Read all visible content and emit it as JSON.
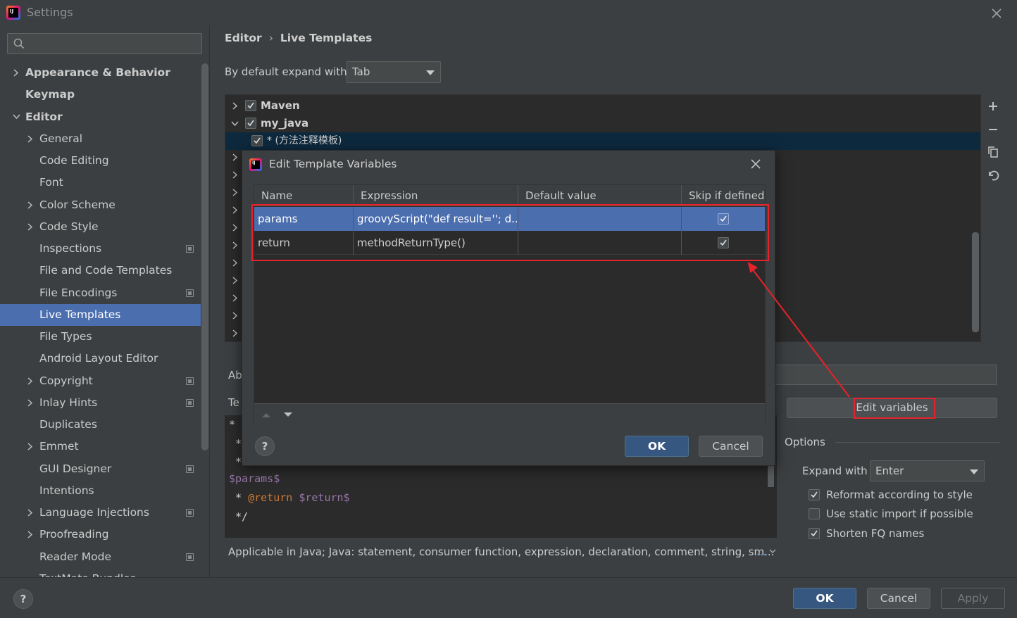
{
  "window": {
    "title": "Settings"
  },
  "sidebar": {
    "search_placeholder": "",
    "items": [
      {
        "label": "Appearance & Behavior",
        "level": 0,
        "expandable": true,
        "expanded": false,
        "bold": true
      },
      {
        "label": "Keymap",
        "level": 0,
        "expandable": false,
        "bold": true
      },
      {
        "label": "Editor",
        "level": 0,
        "expandable": true,
        "expanded": true,
        "bold": true
      },
      {
        "label": "General",
        "level": 1,
        "expandable": true
      },
      {
        "label": "Code Editing",
        "level": 1
      },
      {
        "label": "Font",
        "level": 1
      },
      {
        "label": "Color Scheme",
        "level": 1,
        "expandable": true
      },
      {
        "label": "Code Style",
        "level": 1,
        "expandable": true
      },
      {
        "label": "Inspections",
        "level": 1,
        "project_icon": true
      },
      {
        "label": "File and Code Templates",
        "level": 1
      },
      {
        "label": "File Encodings",
        "level": 1,
        "project_icon": true
      },
      {
        "label": "Live Templates",
        "level": 1,
        "selected": true
      },
      {
        "label": "File Types",
        "level": 1
      },
      {
        "label": "Android Layout Editor",
        "level": 1
      },
      {
        "label": "Copyright",
        "level": 1,
        "expandable": true,
        "project_icon": true
      },
      {
        "label": "Inlay Hints",
        "level": 1,
        "expandable": true,
        "project_icon": true
      },
      {
        "label": "Duplicates",
        "level": 1
      },
      {
        "label": "Emmet",
        "level": 1,
        "expandable": true
      },
      {
        "label": "GUI Designer",
        "level": 1,
        "project_icon": true
      },
      {
        "label": "Intentions",
        "level": 1
      },
      {
        "label": "Language Injections",
        "level": 1,
        "expandable": true,
        "project_icon": true
      },
      {
        "label": "Proofreading",
        "level": 1,
        "expandable": true
      },
      {
        "label": "Reader Mode",
        "level": 1,
        "project_icon": true
      },
      {
        "label": "TextMate Bundles",
        "level": 1
      }
    ]
  },
  "breadcrumb": {
    "parent": "Editor",
    "current": "Live Templates"
  },
  "expand": {
    "label": "By default expand with",
    "value": "Tab"
  },
  "template_tree": {
    "groups": [
      {
        "label": "Maven",
        "checked": true,
        "expanded": false
      },
      {
        "label": "my_java",
        "checked": true,
        "expanded": true
      },
      {
        "label": "* (方法注释模板)",
        "checked": true,
        "child": true,
        "selected": true
      }
    ]
  },
  "toolbar_icons": [
    "add-icon",
    "remove-icon",
    "copy-icon",
    "revert-icon"
  ],
  "abbreviation_label": "Ab",
  "template_text_label": "Te",
  "edit_variables_label": "Edit variables",
  "editor_lines": [
    {
      "text": "*",
      "indent": ""
    },
    {
      "text": "*",
      "indent": " "
    },
    {
      "text": "*",
      "indent": " "
    },
    {
      "text": "$params$",
      "indent": ""
    },
    {
      "prefix": " * ",
      "tag": "@return",
      "var": "$return$"
    },
    {
      "text": "*/",
      "indent": " "
    }
  ],
  "options": {
    "label": "Options",
    "expand_with_label": "Expand with",
    "expand_with_value": "Enter",
    "checkboxes": [
      {
        "label": "Reformat according to style",
        "checked": true
      },
      {
        "label": "Use static import if possible",
        "checked": false
      },
      {
        "label": "Shorten FQ names",
        "checked": true
      }
    ]
  },
  "applicable": {
    "text": "Applicable in Java; Java: statement, consumer function, expression, declaration, comment, string, sm...",
    "more": "..."
  },
  "buttons": {
    "ok": "OK",
    "cancel": "Cancel",
    "apply": "Apply",
    "help": "?"
  },
  "dialog": {
    "title": "Edit Template Variables",
    "columns": [
      "Name",
      "Expression",
      "Default value",
      "Skip if defined"
    ],
    "rows": [
      {
        "name": "params",
        "expression": "groovyScript(\"def result=''; d...",
        "default": "",
        "skip": true,
        "selected": true
      },
      {
        "name": "return",
        "expression": "methodReturnType()",
        "default": "",
        "skip": true,
        "selected": false
      }
    ],
    "ok": "OK",
    "cancel": "Cancel",
    "help": "?"
  },
  "colors": {
    "accent": "#4b6eaf",
    "background": "#3c3f41",
    "editor_bg": "#2b2b2b",
    "highlight": "#e8222a",
    "keyword": "#cc7832",
    "variable": "#9876aa"
  }
}
